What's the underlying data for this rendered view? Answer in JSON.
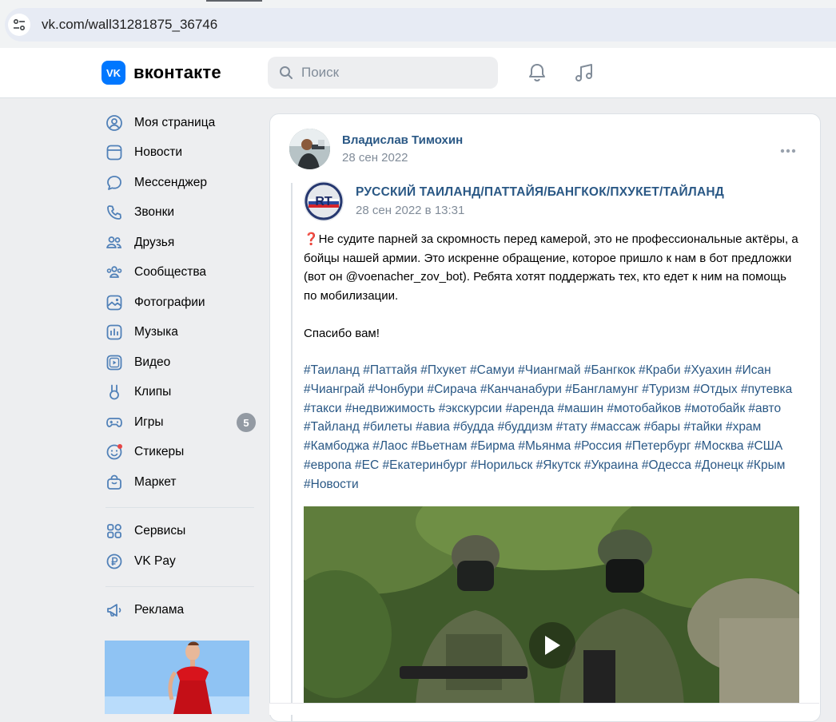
{
  "browser": {
    "url": "vk.com/wall31281875_36746"
  },
  "header": {
    "logo_mark": "VK",
    "logo_text": "вконтакте",
    "search_placeholder": "Поиск",
    "icons": [
      "bell-icon",
      "music-icon"
    ]
  },
  "sidebar": {
    "items": [
      {
        "label": "Моя страница",
        "icon": "user-circle-icon"
      },
      {
        "label": "Новости",
        "icon": "news-icon"
      },
      {
        "label": "Мессенджер",
        "icon": "chat-icon"
      },
      {
        "label": "Звонки",
        "icon": "phone-icon"
      },
      {
        "label": "Друзья",
        "icon": "friends-icon"
      },
      {
        "label": "Сообщества",
        "icon": "communities-icon"
      },
      {
        "label": "Фотографии",
        "icon": "photo-icon"
      },
      {
        "label": "Музыка",
        "icon": "music-icon"
      },
      {
        "label": "Видео",
        "icon": "video-icon"
      },
      {
        "label": "Клипы",
        "icon": "clips-icon"
      },
      {
        "label": "Игры",
        "icon": "gamepad-icon",
        "badge": "5"
      },
      {
        "label": "Стикеры",
        "icon": "sticker-icon"
      },
      {
        "label": "Маркет",
        "icon": "market-icon"
      }
    ],
    "items2": [
      {
        "label": "Сервисы",
        "icon": "services-icon"
      },
      {
        "label": "VK Pay",
        "icon": "vkpay-icon"
      }
    ],
    "items3": [
      {
        "label": "Реклама",
        "icon": "megaphone-icon"
      }
    ]
  },
  "post": {
    "author": "Владислав Тимохин",
    "date": "28 сен 2022",
    "repost": {
      "source_name": "РУССКИЙ ТАИЛАНД/ПАТТАЙЯ/БАНГКОК/ПХУКЕТ/ТАЙЛАНД",
      "avatar_text": "RT",
      "date": "28 сен 2022 в 13:31",
      "text_p1": "❓Не судите парней за скромность перед камерой, это не профессиональные актёры, а бойцы нашей армии. Это искренне обращение, которое пришло к нам в бот предложки (вот он @voenacher_zov_bot). Ребята хотят поддержать тех, кто едет к ним на помощь по мобилизации.",
      "text_p2": "Спасибо вам!",
      "hashtags": "#Таиланд #Паттайя #Пхукет #Самуи #Чиангмай #Бангкок #Краби #Хуахин #Исан #Чианграй #Чонбури #Сирача #Канчанабури #Бангламунг #Туризм #Отдых #путевка #такси #недвижимость #экскурсии #аренда #машин #мотобайков #мотобайк #авто #Тайланд #билеты #авиа #будда #буддизм #тату #массаж #бары #тайки #храм #Камбоджа #Лаос #Вьетнам #Бирма #Мьянма #Россия #Петербург #Москва #США #европа #ЕС #Екатеринбург #Норильск #Якутск #Украина #Одесса #Донецк #Крым #Новости"
    }
  },
  "colors": {
    "vk_blue": "#0077ff",
    "link": "#2a5885",
    "muted": "#818c99",
    "page_bg": "#edeef0"
  }
}
